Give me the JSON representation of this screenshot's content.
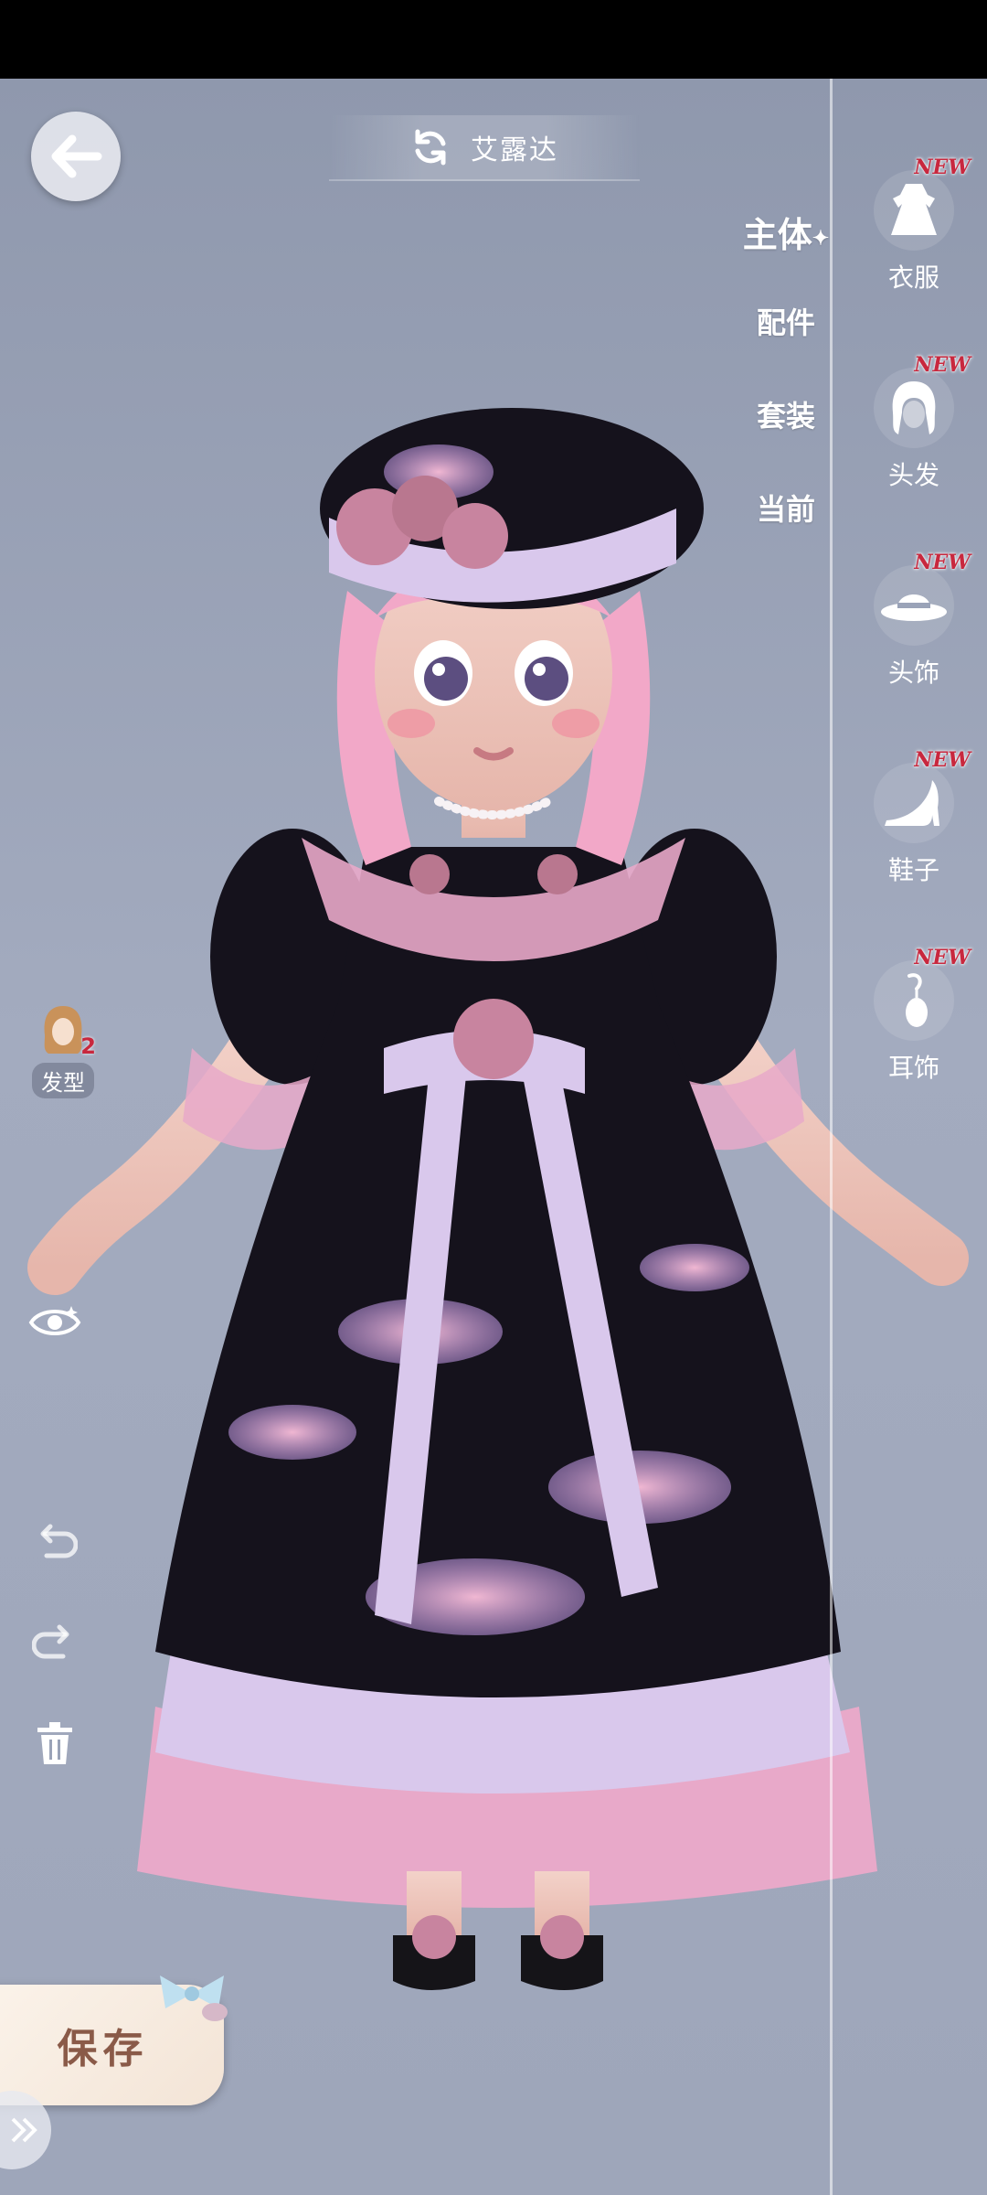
{
  "header": {
    "title": "艾露达"
  },
  "tabs": [
    {
      "label": "主体",
      "active": true
    },
    {
      "label": "配件",
      "active": false
    },
    {
      "label": "套装",
      "active": false
    },
    {
      "label": "当前",
      "active": false
    }
  ],
  "categories": [
    {
      "label": "衣服",
      "icon": "dress-icon",
      "badge": "NEW"
    },
    {
      "label": "头发",
      "icon": "hair-icon",
      "badge": "NEW"
    },
    {
      "label": "头饰",
      "icon": "hat-icon",
      "badge": "NEW"
    },
    {
      "label": "鞋子",
      "icon": "shoe-icon",
      "badge": "NEW"
    },
    {
      "label": "耳饰",
      "icon": "earring-icon",
      "badge": "NEW"
    }
  ],
  "hairstyle": {
    "label": "发型",
    "count": "2"
  },
  "actions": {
    "save_label": "保存"
  },
  "colors": {
    "accent": "#c8283e",
    "save_text": "#8a5a48",
    "dress_black": "#15121c",
    "dress_lilac": "#d9c8ec",
    "dress_pink": "#e8a9c9"
  }
}
